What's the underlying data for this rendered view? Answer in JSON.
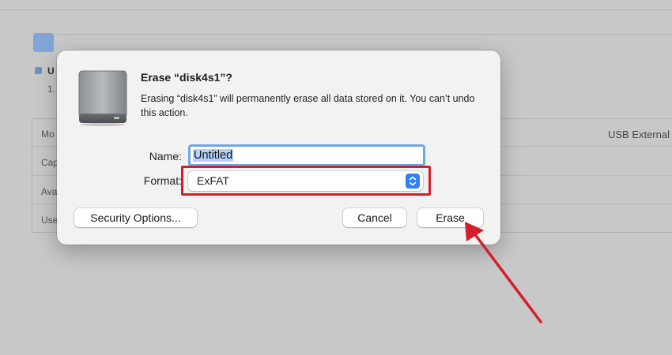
{
  "background": {
    "row_labels": [
      "Mo",
      "Cap",
      "Ava",
      "Use"
    ],
    "volume_label": "U",
    "volume_sub": "1.",
    "connection_label": "USB External"
  },
  "dialog": {
    "title": "Erase “disk4s1”?",
    "message": "Erasing “disk4s1” will permanently erase all data stored on it. You can’t undo this action.",
    "name_label": "Name:",
    "name_value": "Untitled",
    "format_label": "Format:",
    "format_value": "ExFAT",
    "buttons": {
      "security": "Security Options...",
      "cancel": "Cancel",
      "erase": "Erase"
    }
  },
  "colors": {
    "annotation": "#d31f2a",
    "accent": "#2f7ff5",
    "focus_ring": "#6fa6e6"
  },
  "icons": {
    "disk": "external-drive-icon",
    "stepper": "chevron-up-down-icon",
    "annotation_arrow": "arrow-icon"
  }
}
